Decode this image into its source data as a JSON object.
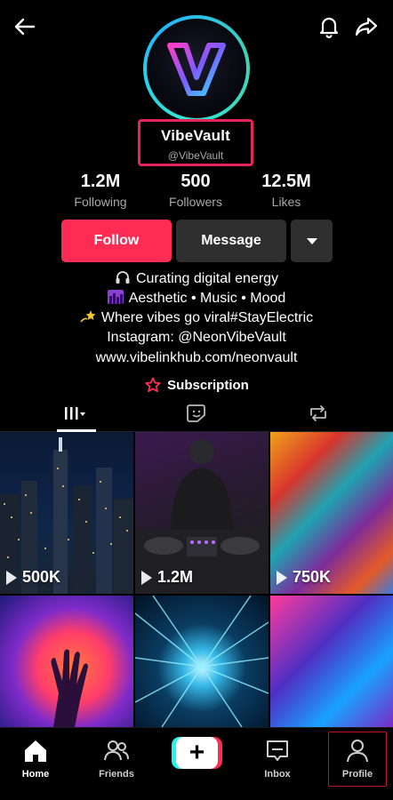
{
  "profile": {
    "display_name": "VibeVault",
    "handle": "@VibeVault"
  },
  "stats": [
    {
      "value": "1.2M",
      "label": "Following"
    },
    {
      "value": "500",
      "label": "Followers"
    },
    {
      "value": "12.5M",
      "label": "Likes"
    }
  ],
  "actions": {
    "follow_label": "Follow",
    "message_label": "Message"
  },
  "bio": {
    "lines": [
      "Curating digital energy",
      "Aesthetic • Music • Mood",
      "Where vibes go viral#StayElectric",
      "Instagram: @NeonVibeVault"
    ],
    "link": "www.vibelinkhub.com/neonvault",
    "subscription": "Subscription"
  },
  "videos": [
    {
      "views": "500K"
    },
    {
      "views": "1.2M"
    },
    {
      "views": "750K"
    }
  ],
  "nav": {
    "home": "Home",
    "friends": "Friends",
    "create": "+",
    "inbox": "Inbox",
    "profile": "Profile"
  },
  "colors": {
    "accent": "#fe2c55",
    "highlight_border": "#e6245a",
    "avatar_ring": "#2ee6d6"
  }
}
